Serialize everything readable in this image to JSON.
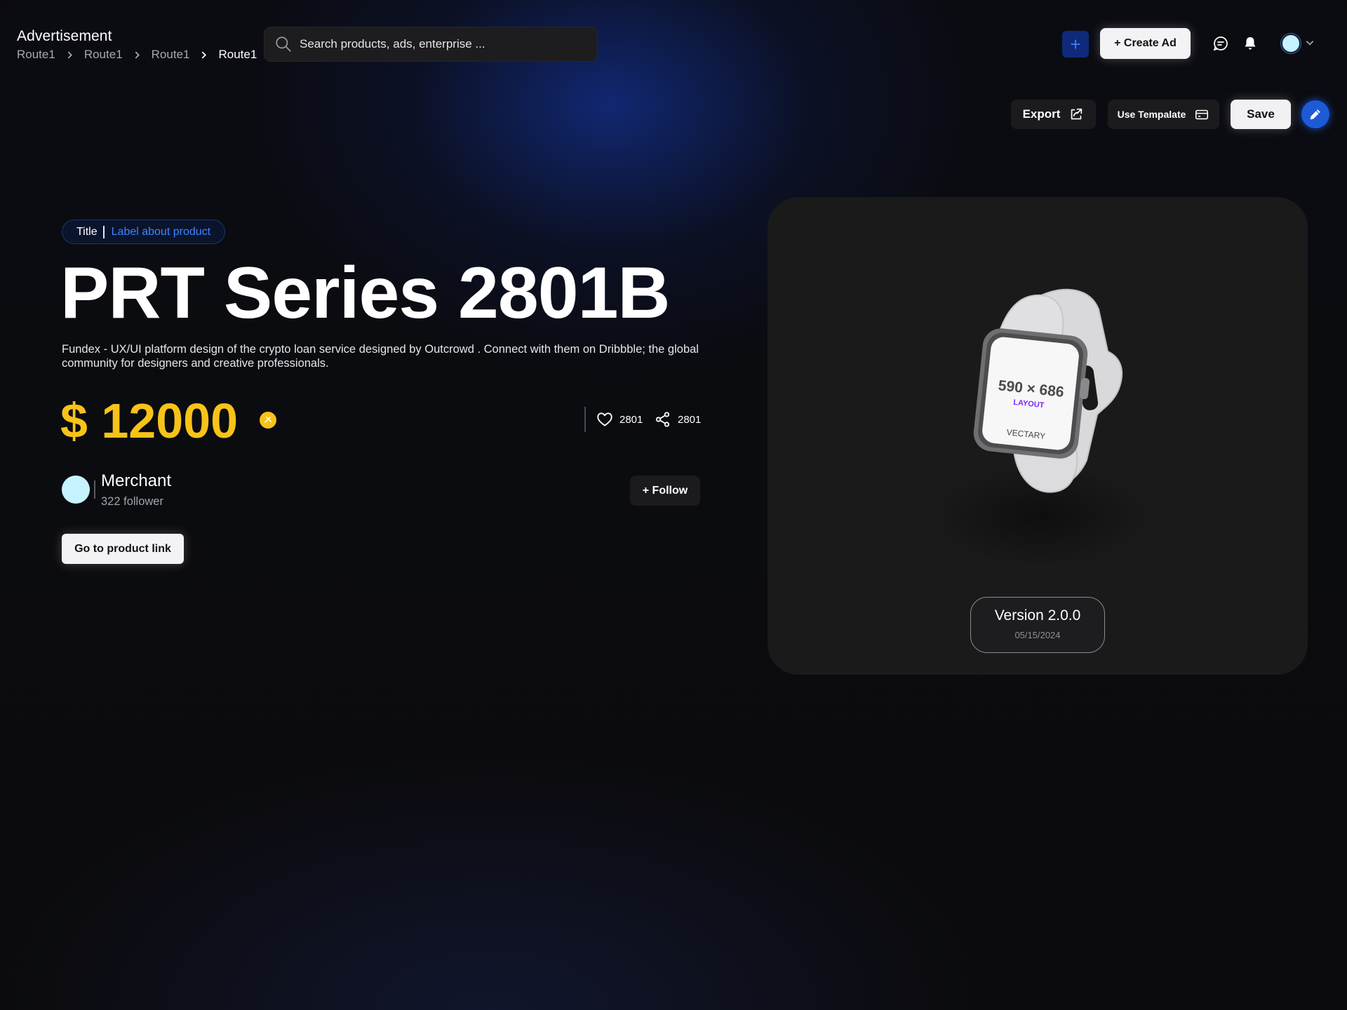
{
  "app": {
    "title": "Advertisement"
  },
  "breadcrumb": [
    "Route1",
    "Route1",
    "Route1",
    "Route1"
  ],
  "search": {
    "placeholder": "Search products, ads, enterprise ..."
  },
  "header": {
    "add_icon": "plus-icon",
    "create_ad_label": "+ Create Ad",
    "chat_icon": "chat-icon",
    "notification_icon": "bell-icon",
    "avatar_color": "#c6f3ff"
  },
  "toolbar": {
    "export_label": "Export",
    "export_icon": "share-out-icon",
    "template_label": "Use Tempalate",
    "template_icon": "card-icon",
    "save_label": "Save",
    "edit_icon": "pencil-icon"
  },
  "product": {
    "tag_title": "Title",
    "tag_label": "Label about product",
    "name": "PRT Series 2801B",
    "description": "Fundex - UX/UI platform design of the crypto loan service designed by Outcrowd . Connect with them on Dribbble; the global community for designers and creative professionals.",
    "price": "$ 12000",
    "price_color": "#f8c318",
    "likes": "2801",
    "shares": "2801",
    "link_label": "Go to product link",
    "image": {
      "screen_size": "590 × 686",
      "screen_layout": "LAYOUT",
      "screen_brand": "VECTARY"
    },
    "version": {
      "label": "Version 2.0.0",
      "date": "05/15/2024"
    }
  },
  "merchant": {
    "name": "Merchant",
    "followers": "322 follower",
    "follow_label": "+ Follow",
    "avatar_color": "#c6f3ff"
  },
  "colors": {
    "accent": "#3d86ff",
    "primary_button": "#1d5bd6",
    "background": "#0b0b0d"
  }
}
